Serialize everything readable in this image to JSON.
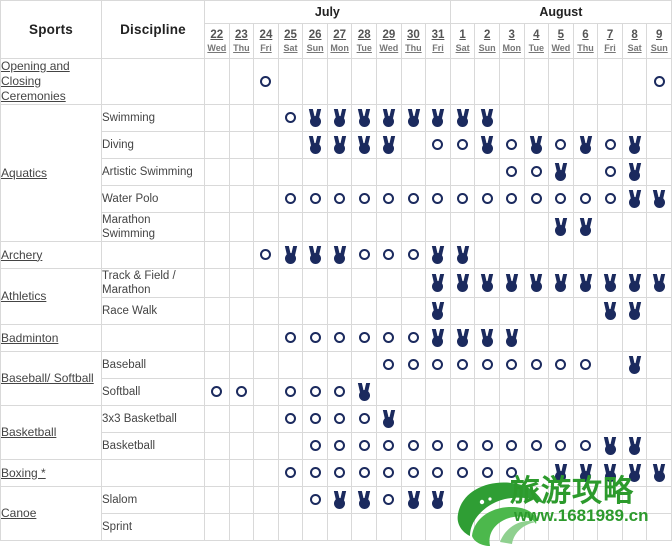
{
  "header": {
    "sports_label": "Sports",
    "discipline_label": "Discipline",
    "months": [
      {
        "name": "July",
        "span": 10
      },
      {
        "name": "August",
        "span": 9
      }
    ],
    "days": [
      {
        "num": "22",
        "name": "Wed"
      },
      {
        "num": "23",
        "name": "Thu"
      },
      {
        "num": "24",
        "name": "Fri"
      },
      {
        "num": "25",
        "name": "Sat"
      },
      {
        "num": "26",
        "name": "Sun"
      },
      {
        "num": "27",
        "name": "Mon"
      },
      {
        "num": "28",
        "name": "Tue"
      },
      {
        "num": "29",
        "name": "Wed"
      },
      {
        "num": "30",
        "name": "Thu"
      },
      {
        "num": "31",
        "name": "Fri"
      },
      {
        "num": "1",
        "name": "Sat"
      },
      {
        "num": "2",
        "name": "Sun"
      },
      {
        "num": "3",
        "name": "Mon"
      },
      {
        "num": "4",
        "name": "Tue"
      },
      {
        "num": "5",
        "name": "Wed"
      },
      {
        "num": "6",
        "name": "Thu"
      },
      {
        "num": "7",
        "name": "Fri"
      },
      {
        "num": "8",
        "name": "Sat"
      },
      {
        "num": "9",
        "name": "Sun"
      }
    ]
  },
  "legend": {
    "ring_meaning": "competition",
    "medal_meaning": "medal-event"
  },
  "colors": {
    "icon": "#1b2a5e",
    "header_bg": "#f7f7f7",
    "border": "#d9d9d9",
    "text": "#444444",
    "watermark": "#2c9a2c"
  },
  "watermark": {
    "chinese": "旅游攻略",
    "url": "www.1681989.cn"
  },
  "rows": [
    {
      "sport": "Opening and Closing Ceremonies",
      "sport_rowspan": 1,
      "show_sport": true,
      "discipline": "",
      "cells": [
        "",
        "",
        "o",
        "",
        "",
        "",
        "",
        "",
        "",
        "",
        "",
        "",
        "",
        "",
        "",
        "",
        "",
        "",
        "o"
      ]
    },
    {
      "sport": "Aquatics",
      "sport_rowspan": 5,
      "show_sport": true,
      "discipline": "Swimming",
      "cells": [
        "",
        "",
        "",
        "o",
        "m",
        "m",
        "m",
        "m",
        "m",
        "m",
        "m",
        "m",
        "",
        "",
        "",
        "",
        "",
        "",
        ""
      ]
    },
    {
      "sport": "Aquatics",
      "show_sport": false,
      "discipline": "Diving",
      "cells": [
        "",
        "",
        "",
        "",
        "m",
        "m",
        "m",
        "m",
        "",
        "o",
        "o",
        "m",
        "o",
        "m",
        "o",
        "m",
        "o",
        "m",
        ""
      ]
    },
    {
      "sport": "Aquatics",
      "show_sport": false,
      "discipline": "Artistic Swimming",
      "cells": [
        "",
        "",
        "",
        "",
        "",
        "",
        "",
        "",
        "",
        "",
        "",
        "",
        "o",
        "o",
        "m",
        "",
        "o",
        "m",
        ""
      ]
    },
    {
      "sport": "Aquatics",
      "show_sport": false,
      "discipline": "Water Polo",
      "cells": [
        "",
        "",
        "",
        "o",
        "o",
        "o",
        "o",
        "o",
        "o",
        "o",
        "o",
        "o",
        "o",
        "o",
        "o",
        "o",
        "o",
        "m",
        "m"
      ]
    },
    {
      "sport": "Aquatics",
      "show_sport": false,
      "discipline": "Marathon Swimming",
      "cells": [
        "",
        "",
        "",
        "",
        "",
        "",
        "",
        "",
        "",
        "",
        "",
        "",
        "",
        "",
        "m",
        "m",
        "",
        "",
        ""
      ]
    },
    {
      "sport": "Archery",
      "sport_rowspan": 1,
      "show_sport": true,
      "discipline": "",
      "cells": [
        "",
        "",
        "o",
        "m",
        "m",
        "m",
        "o",
        "o",
        "o",
        "m",
        "m",
        "",
        "",
        "",
        "",
        "",
        "",
        "",
        ""
      ]
    },
    {
      "sport": "Athletics",
      "sport_rowspan": 2,
      "show_sport": true,
      "discipline": "Track & Field / Marathon",
      "cells": [
        "",
        "",
        "",
        "",
        "",
        "",
        "",
        "",
        "",
        "m",
        "m",
        "m",
        "m",
        "m",
        "m",
        "m",
        "m",
        "m",
        "m"
      ]
    },
    {
      "sport": "Athletics",
      "show_sport": false,
      "discipline": "Race Walk",
      "cells": [
        "",
        "",
        "",
        "",
        "",
        "",
        "",
        "",
        "",
        "m",
        "",
        "",
        "",
        "",
        "",
        "",
        "m",
        "m",
        ""
      ]
    },
    {
      "sport": "Badminton",
      "sport_rowspan": 1,
      "show_sport": true,
      "discipline": "",
      "cells": [
        "",
        "",
        "",
        "o",
        "o",
        "o",
        "o",
        "o",
        "o",
        "m",
        "m",
        "m",
        "m",
        "",
        "",
        "",
        "",
        "",
        ""
      ]
    },
    {
      "sport": "Baseball/ Softball",
      "sport_rowspan": 2,
      "show_sport": true,
      "discipline": "Baseball",
      "cells": [
        "",
        "",
        "",
        "",
        "",
        "",
        "",
        "o",
        "o",
        "o",
        "o",
        "o",
        "o",
        "o",
        "o",
        "o",
        "",
        "m",
        ""
      ]
    },
    {
      "sport": "Baseball/ Softball",
      "show_sport": false,
      "discipline": "Softball",
      "cells": [
        "o",
        "o",
        "",
        "o",
        "o",
        "o",
        "m",
        "",
        "",
        "",
        "",
        "",
        "",
        "",
        "",
        "",
        "",
        "",
        ""
      ]
    },
    {
      "sport": "Basketball",
      "sport_rowspan": 2,
      "show_sport": true,
      "discipline": "3x3 Basketball",
      "cells": [
        "",
        "",
        "",
        "o",
        "o",
        "o",
        "o",
        "m",
        "",
        "",
        "",
        "",
        "",
        "",
        "",
        "",
        "",
        "",
        ""
      ]
    },
    {
      "sport": "Basketball",
      "show_sport": false,
      "discipline": "Basketball",
      "cells": [
        "",
        "",
        "",
        "",
        "o",
        "o",
        "o",
        "o",
        "o",
        "o",
        "o",
        "o",
        "o",
        "o",
        "o",
        "o",
        "m",
        "m",
        ""
      ]
    },
    {
      "sport": "Boxing *",
      "sport_rowspan": 1,
      "show_sport": true,
      "discipline": "",
      "cells": [
        "",
        "",
        "",
        "o",
        "o",
        "o",
        "o",
        "o",
        "o",
        "o",
        "o",
        "o",
        "o",
        "",
        "m",
        "m",
        "m",
        "m",
        "m"
      ]
    },
    {
      "sport": "Canoe",
      "sport_rowspan": 2,
      "show_sport": true,
      "discipline": "Slalom",
      "cells": [
        "",
        "",
        "",
        "",
        "o",
        "m",
        "m",
        "o",
        "m",
        "m",
        "",
        "",
        "",
        "",
        "",
        "",
        "",
        "",
        ""
      ]
    },
    {
      "sport": "Canoe",
      "show_sport": false,
      "discipline": "Sprint",
      "cells": [
        "",
        "",
        "",
        "",
        "",
        "",
        "",
        "",
        "",
        "",
        "",
        "",
        "",
        "",
        "",
        "",
        "",
        "",
        ""
      ]
    }
  ]
}
